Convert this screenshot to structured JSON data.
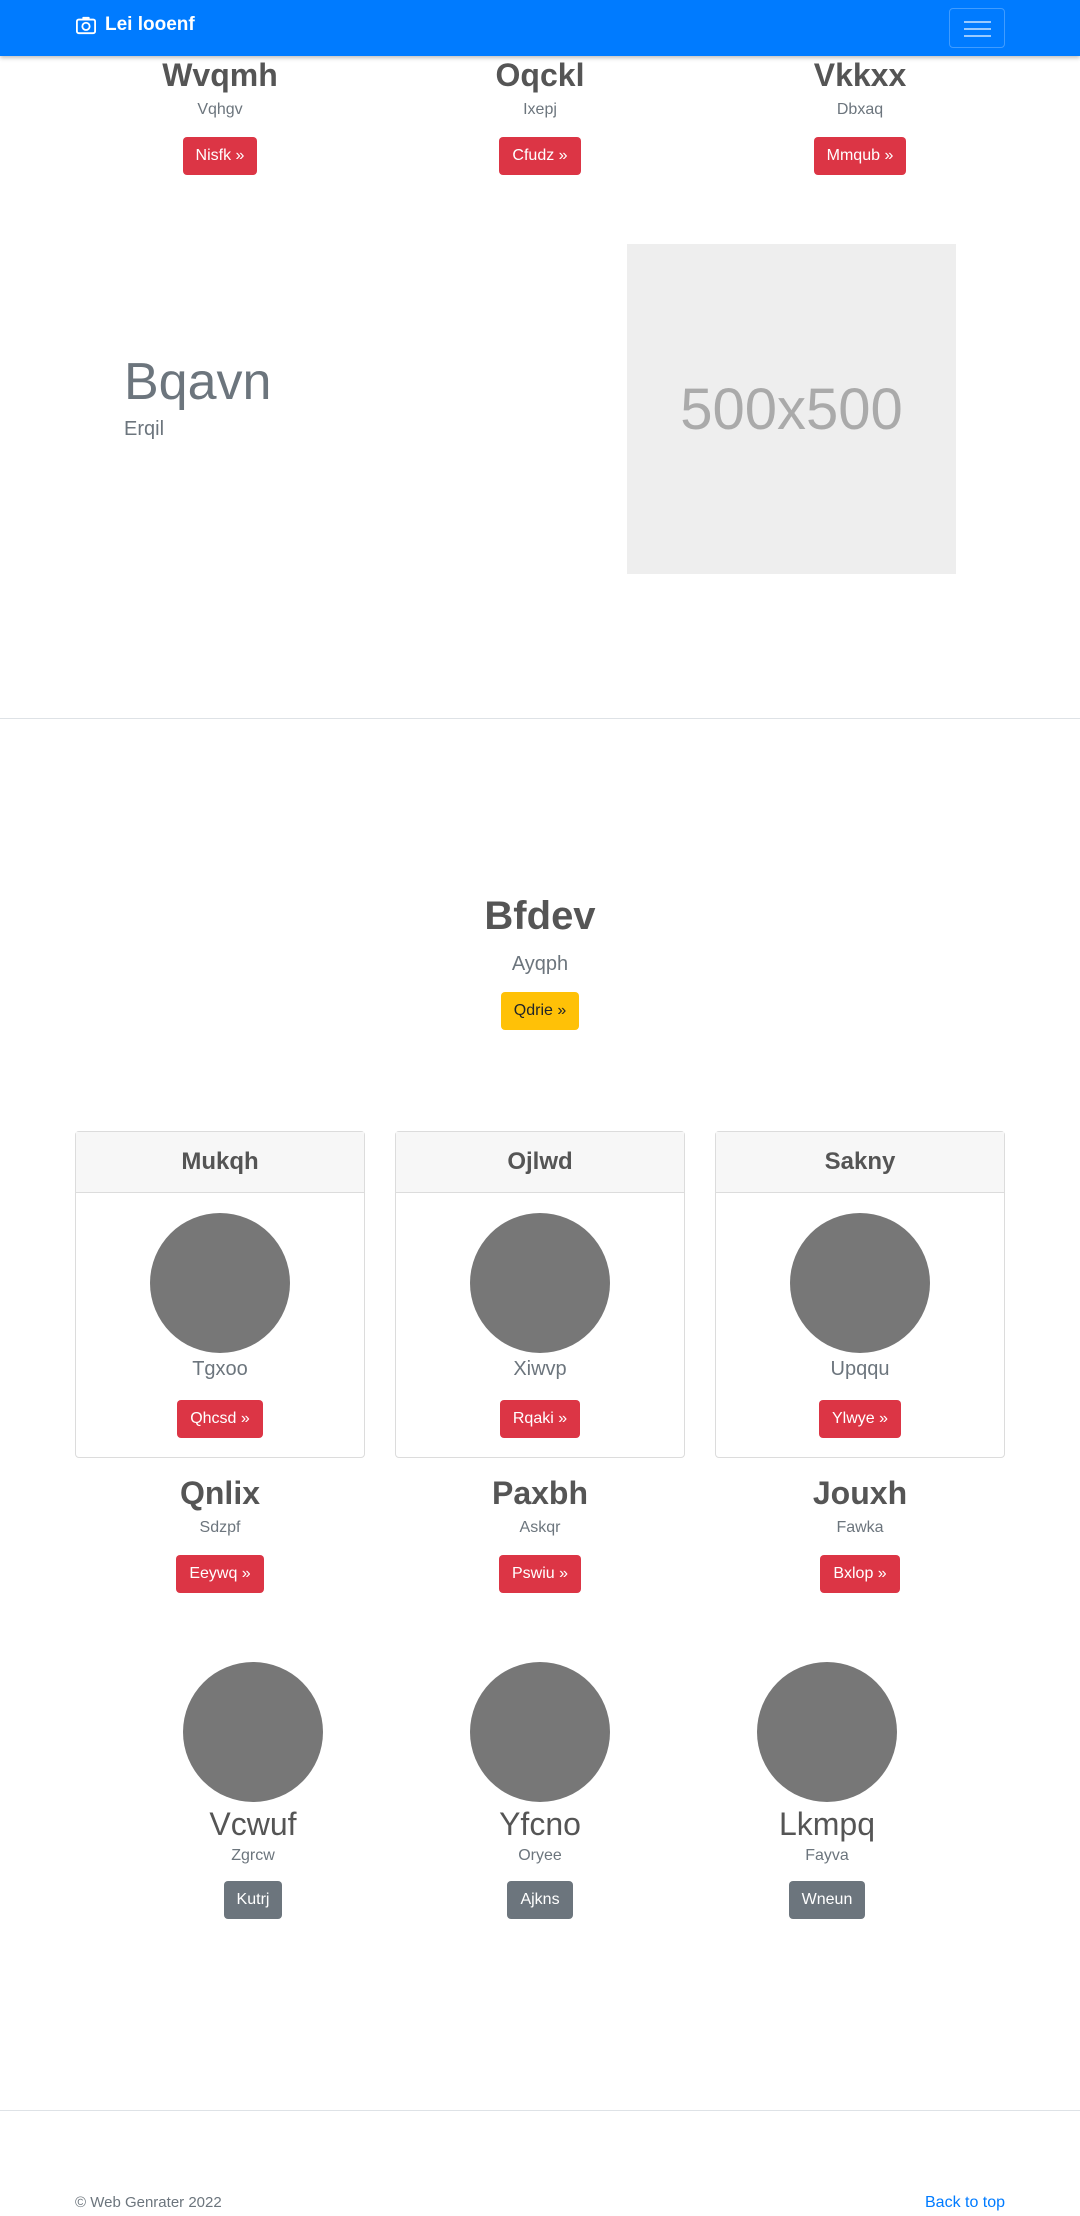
{
  "navbar": {
    "brand": "Lei looenf",
    "brand_icon": "camera-icon",
    "toggler_icon": "hamburger-icon",
    "color": "#007bff"
  },
  "top_columns": [
    {
      "title": "Wvqmh",
      "subtitle": "Vqhgv",
      "button": "Nisfk »"
    },
    {
      "title": "Oqckl",
      "subtitle": "Ixepj",
      "button": "Cfudz »"
    },
    {
      "title": "Vkkxx",
      "subtitle": "Dbxaq",
      "button": "Mmqub »"
    }
  ],
  "feature": {
    "title": "Bqavn",
    "subtitle": "Erqil",
    "image_label": "500x500"
  },
  "hero": {
    "title": "Bfdev",
    "subtitle": "Ayqph",
    "button": "Qdrie »"
  },
  "cards": [
    {
      "header": "Mukqh",
      "caption": "Tgxoo",
      "button": "Qhcsd »"
    },
    {
      "header": "Ojlwd",
      "caption": "Xiwvp",
      "button": "Rqaki »"
    },
    {
      "header": "Sakny",
      "caption": "Upqqu",
      "button": "Ylwye »"
    }
  ],
  "mid_columns": [
    {
      "title": "Qnlix",
      "subtitle": "Sdzpf",
      "button": "Eeywq »"
    },
    {
      "title": "Paxbh",
      "subtitle": "Askqr",
      "button": "Pswiu »"
    },
    {
      "title": "Jouxh",
      "subtitle": "Fawka",
      "button": "Bxlop »"
    }
  ],
  "profiles": [
    {
      "name": "Vcwuf",
      "subtitle": "Zgrcw",
      "button": "Kutrj"
    },
    {
      "name": "Yfcno",
      "subtitle": "Oryee",
      "button": "Ajkns"
    },
    {
      "name": "Lkmpq",
      "subtitle": "Fayva",
      "button": "Wneun"
    }
  ],
  "footer": {
    "copyright": "© Web Genrater 2022",
    "back_to_top": "Back to top"
  },
  "colors": {
    "danger": "#dc3545",
    "warning": "#ffc107",
    "secondary": "#6c757d",
    "placeholder": "#777777"
  }
}
